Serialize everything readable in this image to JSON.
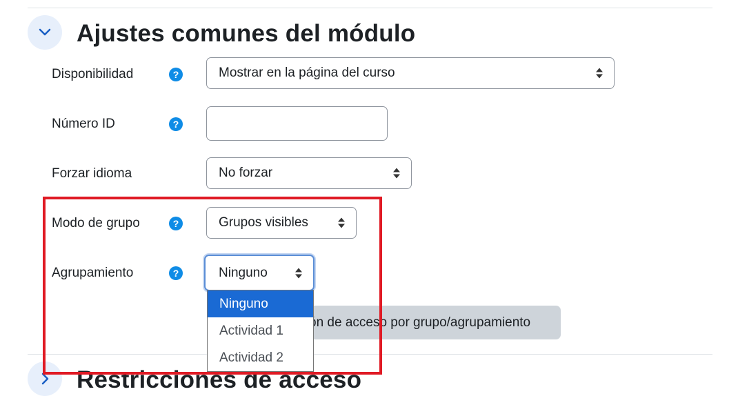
{
  "section_general": {
    "title": "Ajustes comunes del módulo",
    "expanded": true
  },
  "fields": {
    "availability": {
      "label": "Disponibilidad",
      "value": "Mostrar en la página del curso"
    },
    "id_number": {
      "label": "Número ID",
      "value": ""
    },
    "force_language": {
      "label": "Forzar idioma",
      "value": "No forzar"
    },
    "group_mode": {
      "label": "Modo de grupo",
      "value": "Grupos visibles"
    },
    "grouping": {
      "label": "Agrupamiento",
      "value": "Ninguno",
      "options": [
        "Ninguno",
        "Actividad 1",
        "Actividad 2"
      ],
      "selected_index": 0
    }
  },
  "help_icon_glyph": "?",
  "add_restriction_button": {
    "label": "ón de acceso por grupo/agrupamiento"
  },
  "section_restrictions": {
    "title": "Restricciones de acceso",
    "expanded": false
  },
  "colors": {
    "accent": "#0f8ce6",
    "selected_option": "#1a6ad4",
    "highlight_box": "#e01a24",
    "collapse_bg": "#e7effb"
  }
}
